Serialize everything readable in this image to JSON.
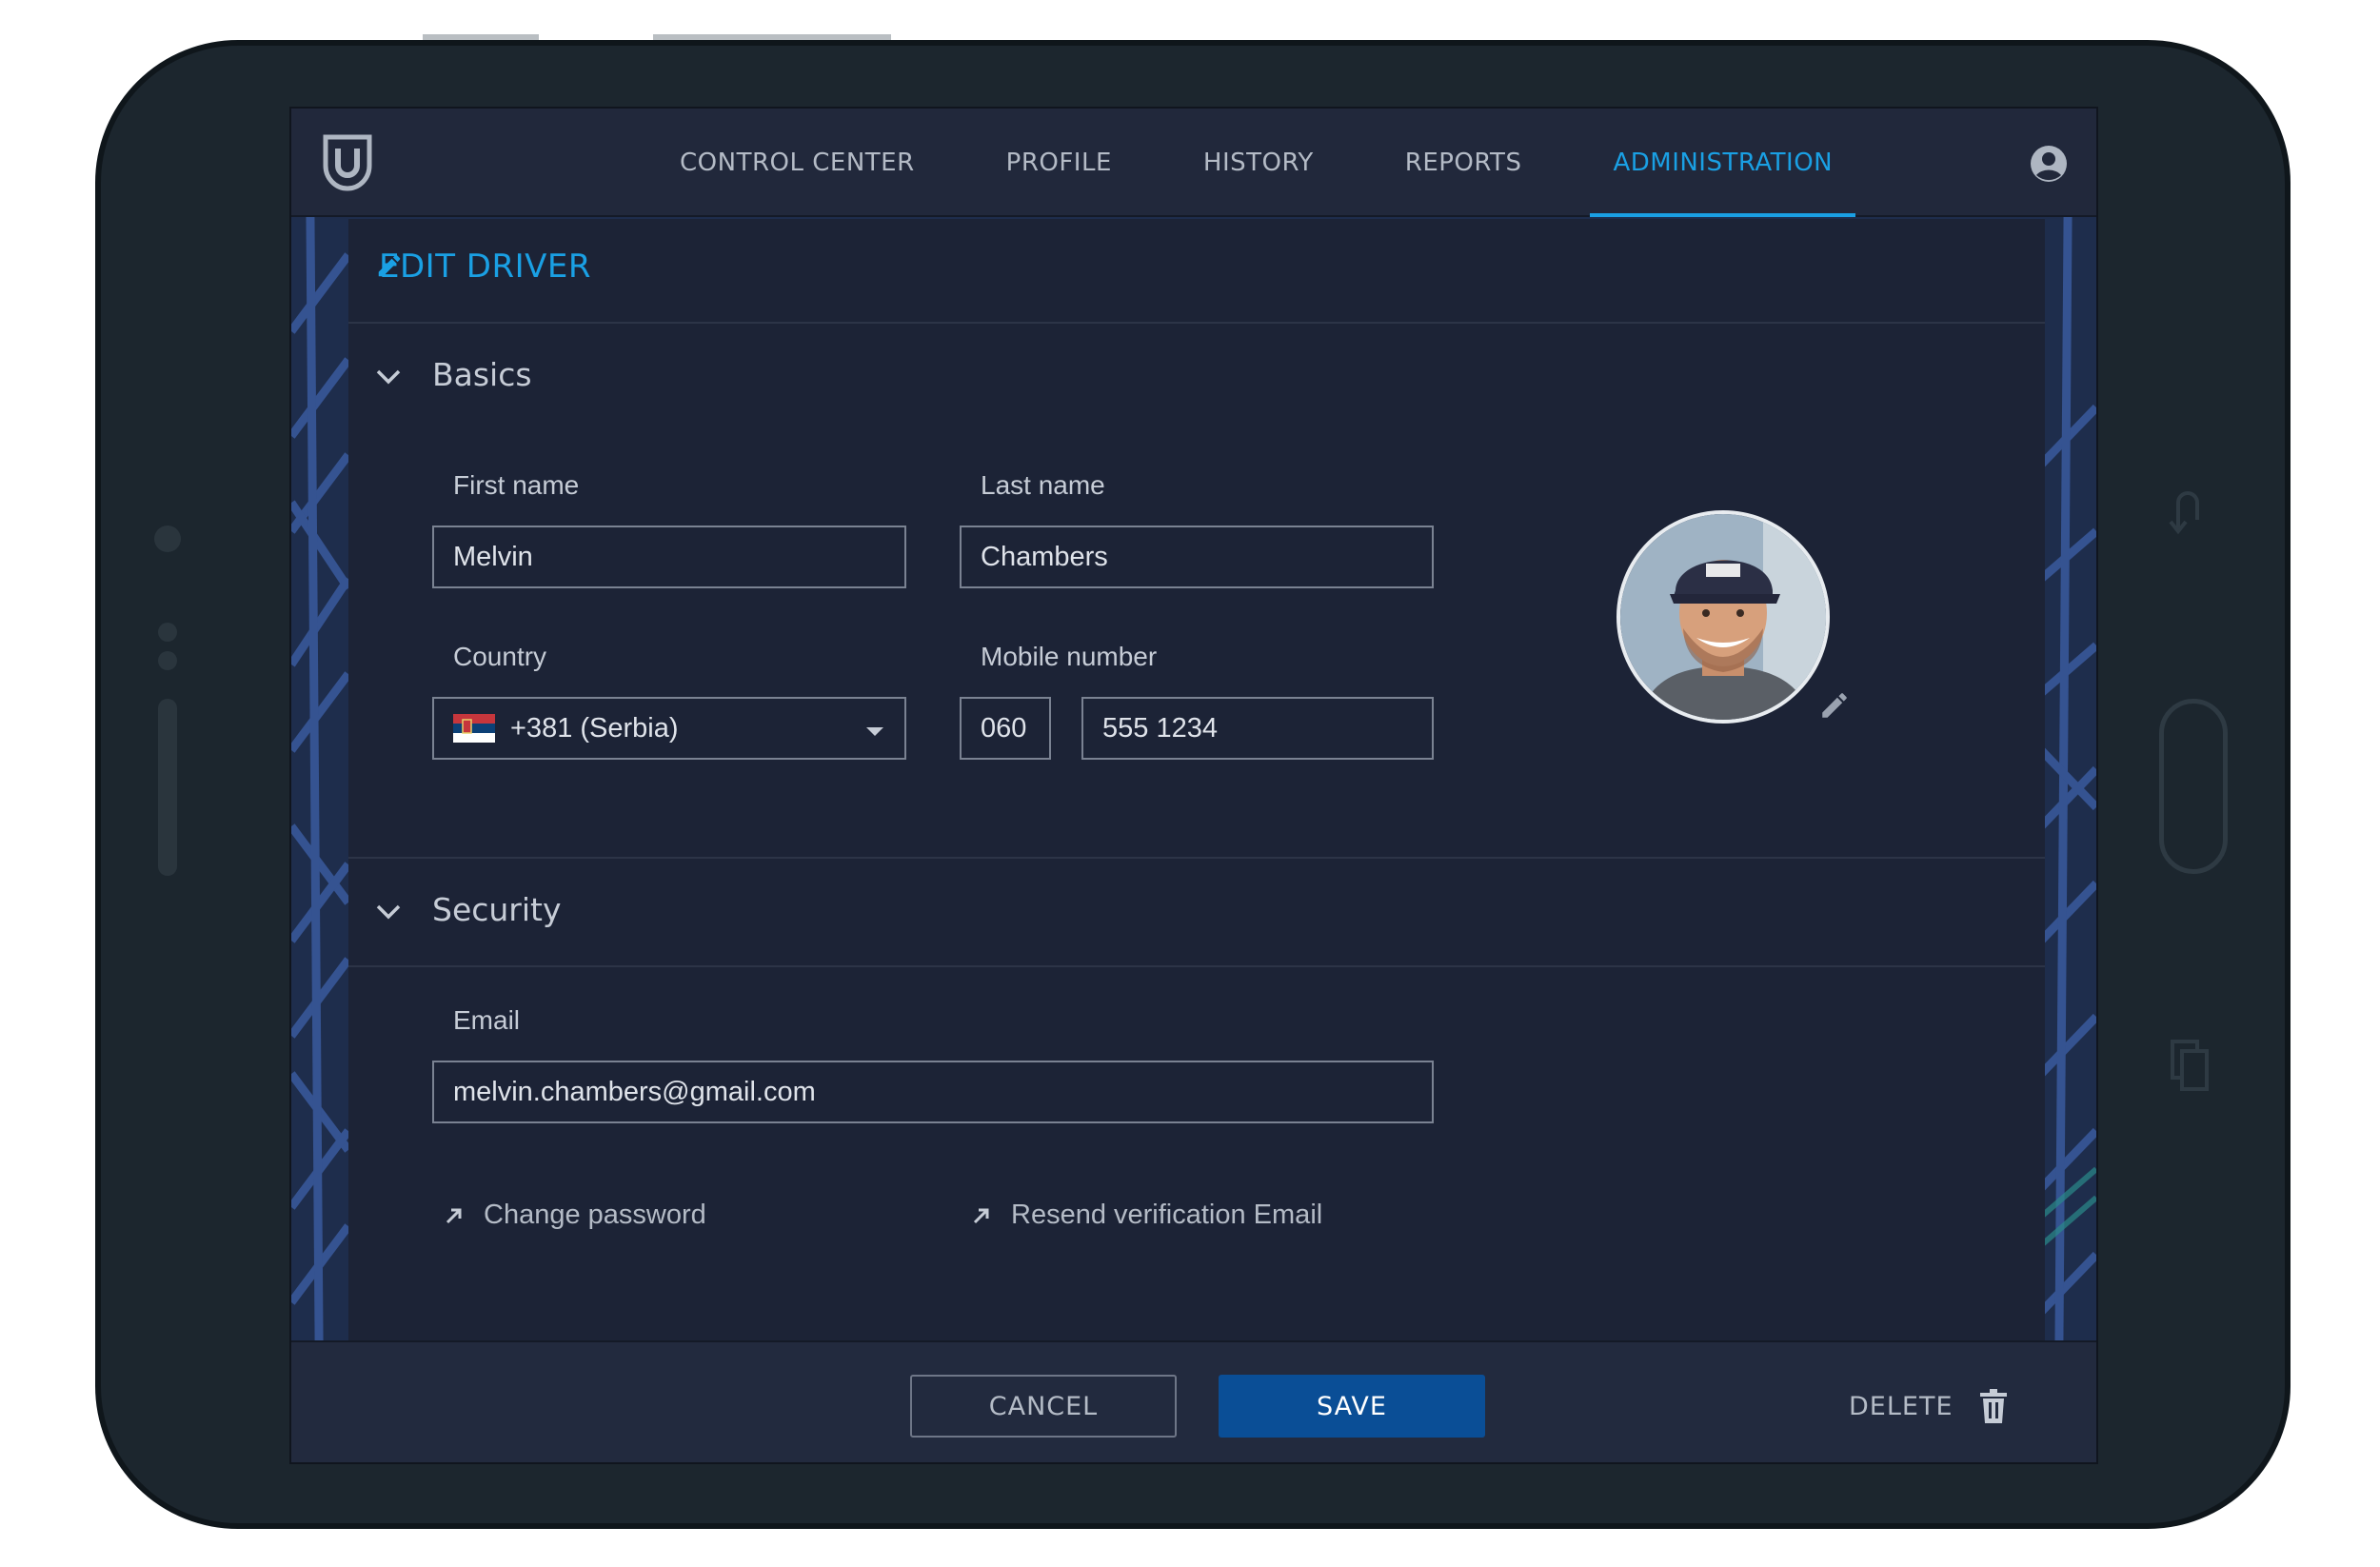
{
  "nav": {
    "items": [
      {
        "label": "CONTROL CENTER"
      },
      {
        "label": "PROFILE"
      },
      {
        "label": "HISTORY"
      },
      {
        "label": "REPORTS"
      },
      {
        "label": "ADMINISTRATION"
      }
    ],
    "active": "ADMINISTRATION"
  },
  "page": {
    "title": "EDIT DRIVER"
  },
  "basics": {
    "title": "Basics",
    "first_name": {
      "label": "First name",
      "value": "Melvin"
    },
    "last_name": {
      "label": "Last name",
      "value": "Chambers"
    },
    "country": {
      "label": "Country",
      "value": "+381 (Serbia)"
    },
    "mobile": {
      "label": "Mobile number",
      "prefix": "060",
      "number": "555 1234"
    }
  },
  "security": {
    "title": "Security",
    "email": {
      "label": "Email",
      "value": "melvin.chambers@gmail.com"
    },
    "change_password": "Change password",
    "resend_verification": "Resend verification Email"
  },
  "footer": {
    "cancel": "CANCEL",
    "save": "SAVE",
    "delete": "DELETE"
  },
  "colors": {
    "accent": "#1aa0e4",
    "save": "#0a4e96",
    "panel": "#1c2336"
  }
}
